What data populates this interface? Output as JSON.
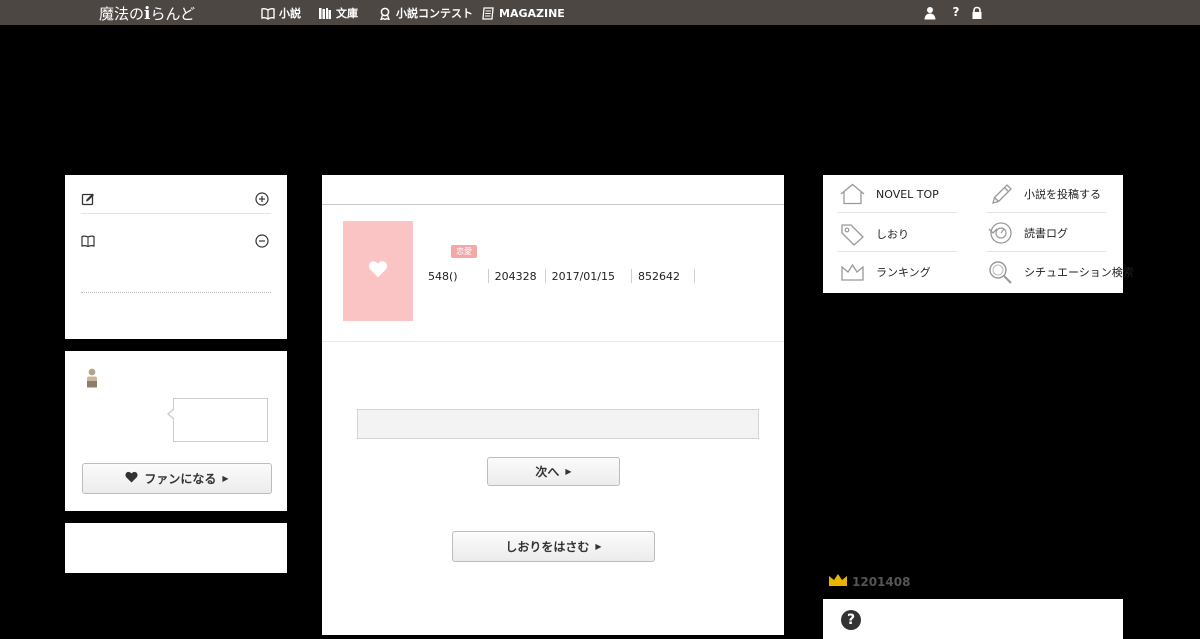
{
  "header": {
    "logo_text": "魔法の",
    "logo_i": "i",
    "logo_suffix": "らんど",
    "nav": [
      {
        "label": "小説",
        "icon": "book-open-icon"
      },
      {
        "label": "文庫",
        "icon": "bookshelf-icon"
      },
      {
        "label": "小説コンテスト",
        "icon": "award-ribbon-icon"
      },
      {
        "label": "MAGAZINE",
        "icon": "magazine-icon"
      }
    ],
    "right_icons": [
      "user-icon",
      "help-icon",
      "lock-icon"
    ],
    "help_glyph": "?"
  },
  "left_panel": {
    "icons": [
      "edit-icon",
      "plus-circle-icon",
      "book-icon",
      "minus-circle-icon"
    ]
  },
  "author_panel": {
    "fan_button_label": "ファンになる",
    "icons": [
      "avatar-icon",
      "heart-icon"
    ]
  },
  "novel": {
    "genre_badge": "恋愛",
    "stats": [
      "548()",
      "204328",
      "2017/01/15",
      "852642"
    ],
    "next_button_label": "次へ",
    "bookmark_button_label": "しおりをはさむ",
    "cover_color": "#fbc4c4"
  },
  "side_menu": {
    "items": [
      {
        "label": "NOVEL TOP",
        "icon": "home-icon"
      },
      {
        "label": "小説を投稿する",
        "icon": "pencil-icon"
      },
      {
        "label": "しおり",
        "icon": "tag-icon"
      },
      {
        "label": "読書ログ",
        "icon": "reading-log-icon"
      },
      {
        "label": "ランキング",
        "icon": "crown-outline-icon"
      },
      {
        "label": "シチュエーション検索",
        "icon": "search-icon"
      }
    ]
  },
  "ranking": {
    "value": "1201408",
    "icon": "crown-icon"
  },
  "faq": {
    "glyph": "?"
  },
  "colors": {
    "topbar": "#4d4744",
    "background": "#000000",
    "cover": "#fbc4c4",
    "badge": "#f3a7a7",
    "crown": "#e8b400"
  }
}
